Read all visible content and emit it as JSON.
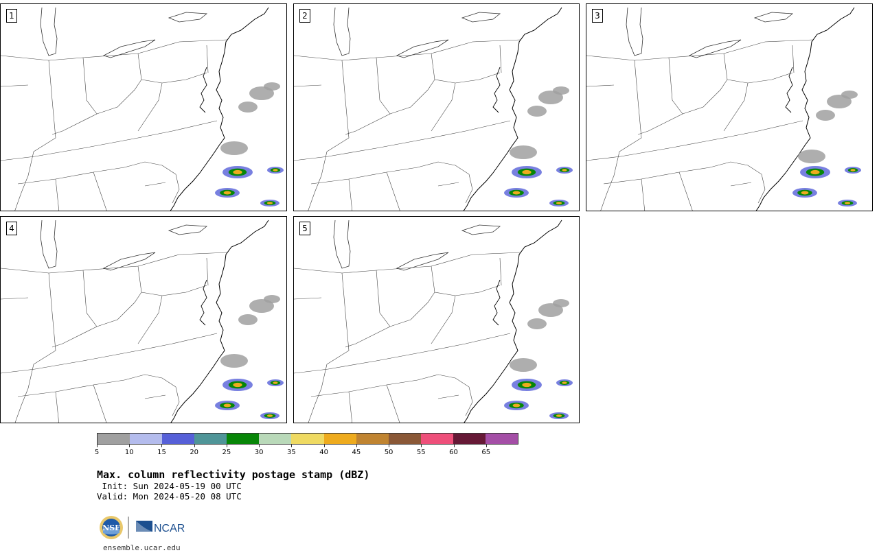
{
  "panels": [
    {
      "label": "1"
    },
    {
      "label": "2"
    },
    {
      "label": "3"
    },
    {
      "label": "4"
    },
    {
      "label": "5"
    }
  ],
  "colorbar": {
    "ticks": [
      "5",
      "10",
      "15",
      "20",
      "25",
      "30",
      "35",
      "40",
      "45",
      "50",
      "55",
      "60",
      "65"
    ],
    "colors": [
      "#a0a0a0",
      "#b4bced",
      "#5660d8",
      "#4f9598",
      "#078607",
      "#b9d9b9",
      "#efda62",
      "#eeab1e",
      "#c08431",
      "#8a5837",
      "#ee4f7a",
      "#661936",
      "#a44ea6"
    ]
  },
  "title": "Max. column reflectivity postage stamp (dBZ)",
  "init": " Init: Sun 2024-05-19 00 UTC",
  "valid": "Valid: Mon 2024-05-20 08 UTC",
  "logo": {
    "agency": "NSF",
    "org": "NCAR"
  },
  "url": "ensemble.ucar.edu"
}
